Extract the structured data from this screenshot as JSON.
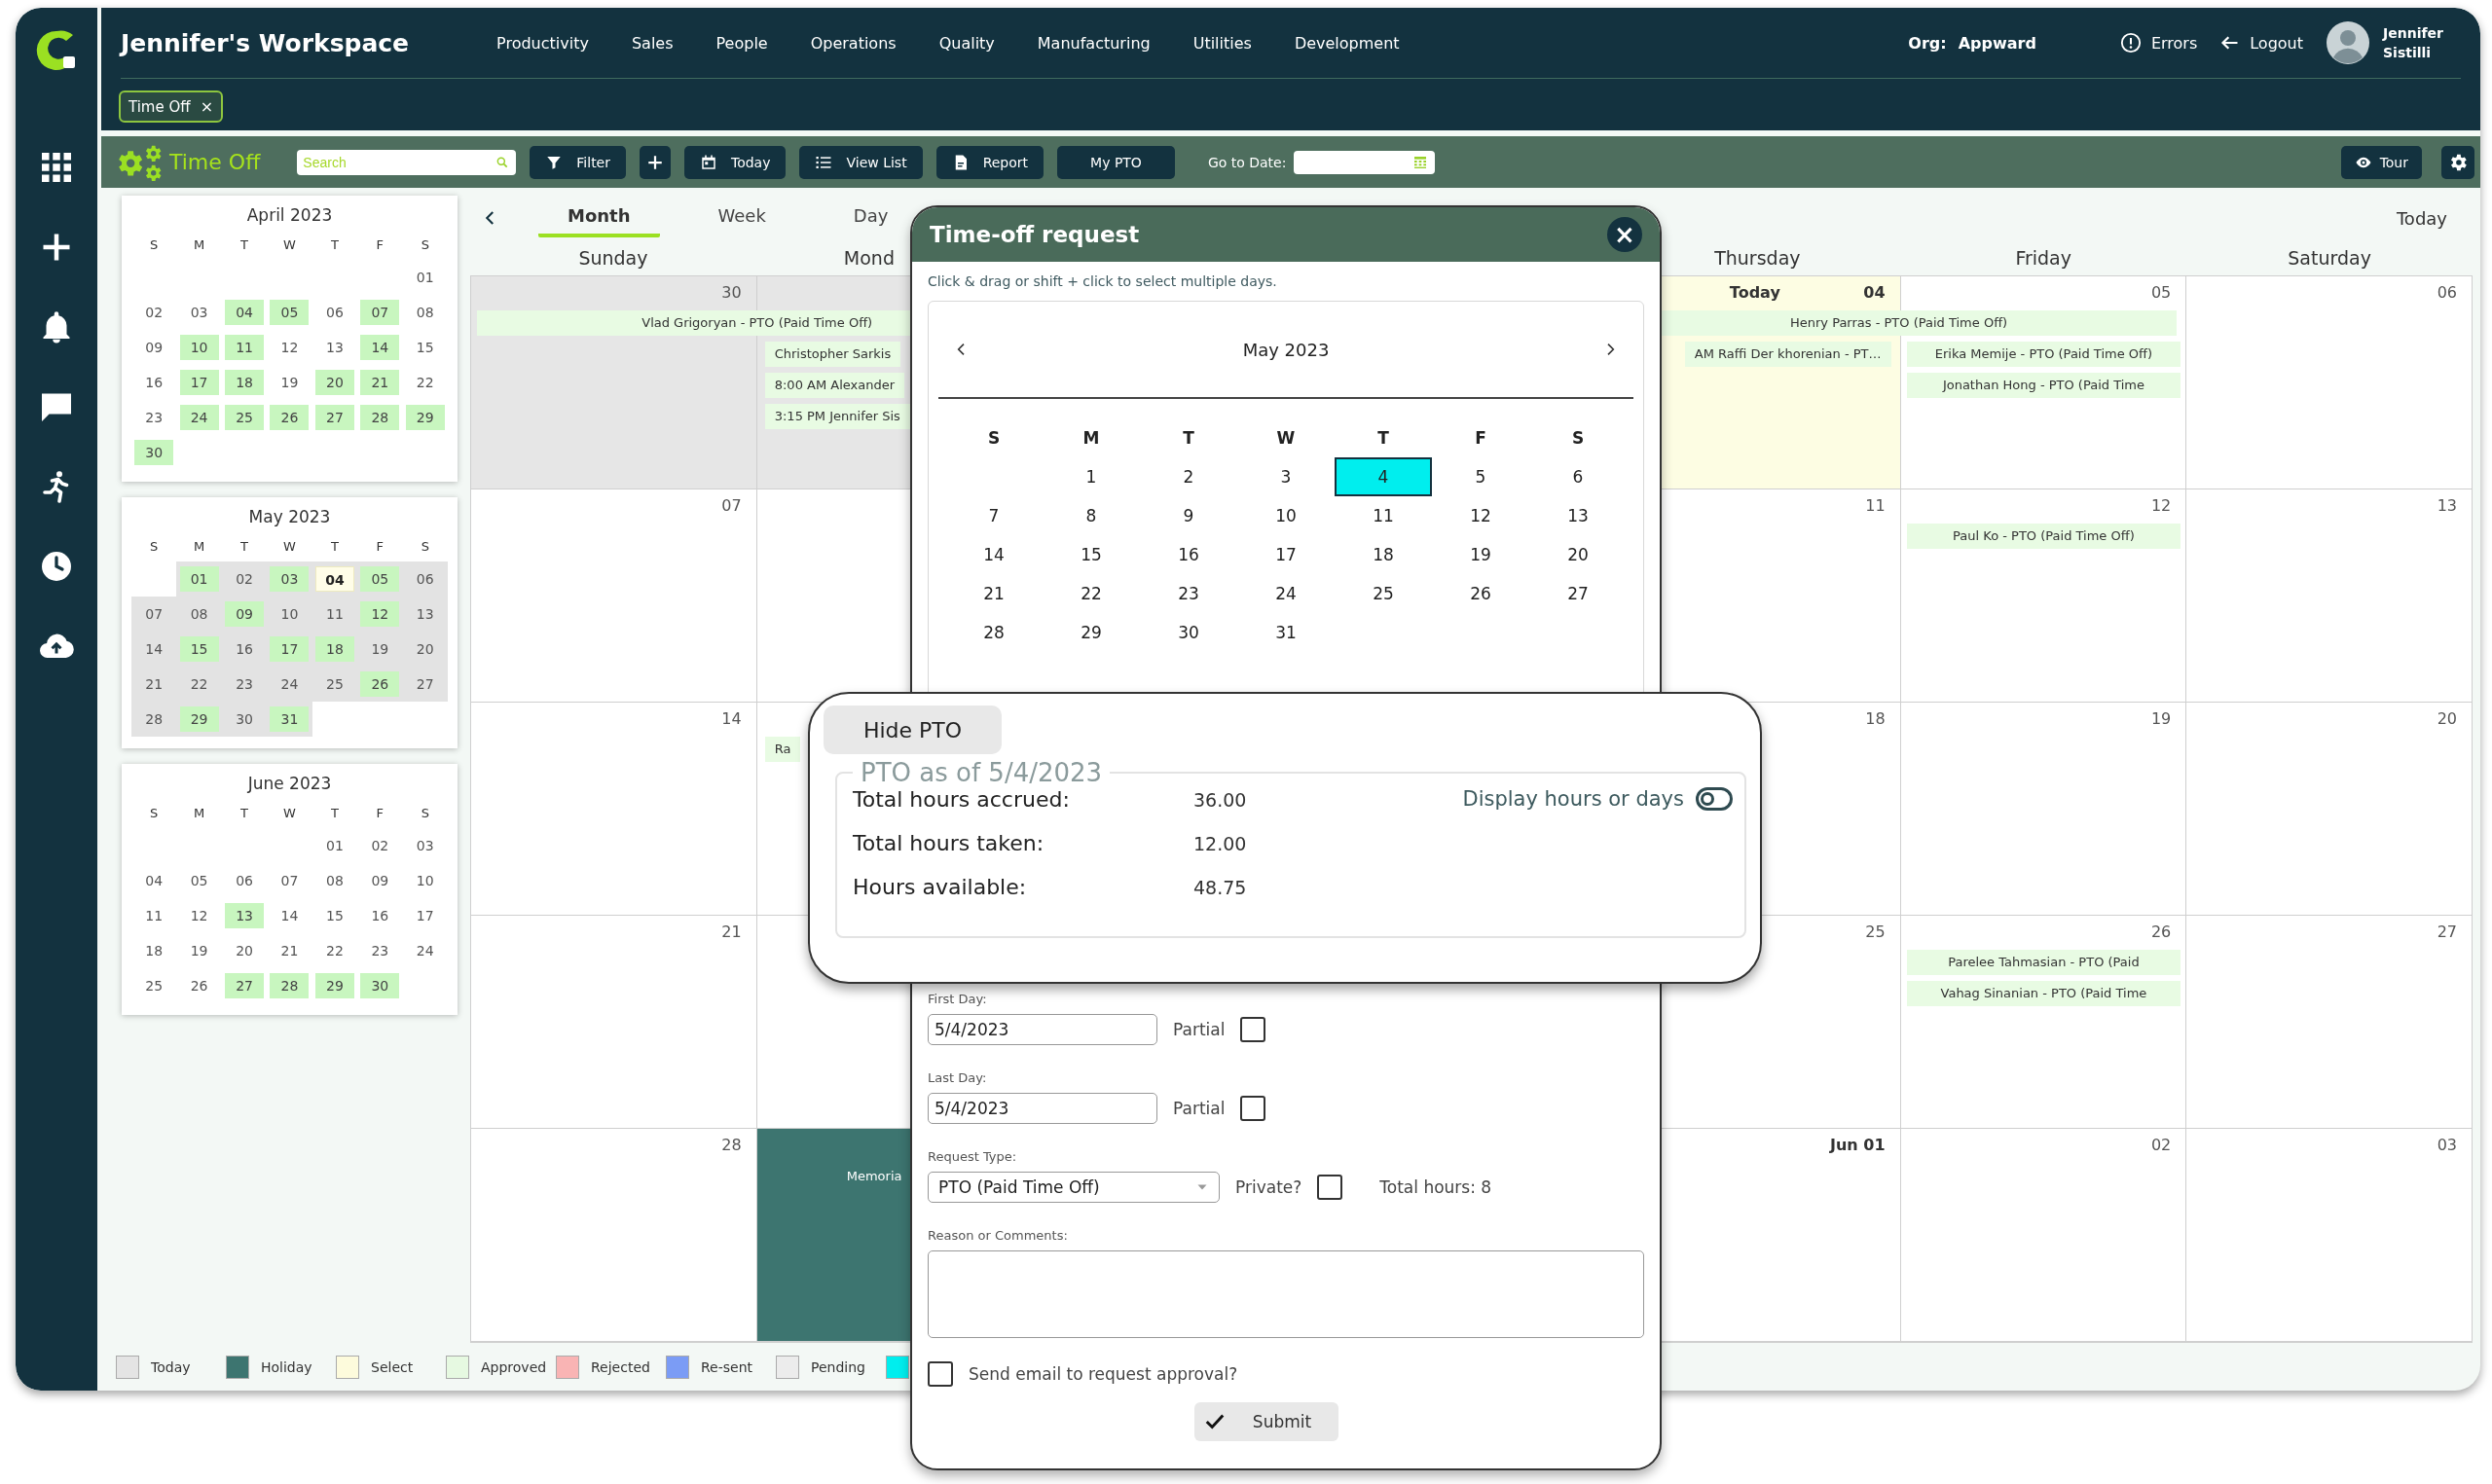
{
  "header": {
    "title": "Jennifer's Workspace",
    "nav": [
      "Productivity",
      "Sales",
      "People",
      "Operations",
      "Quality",
      "Manufacturing",
      "Utilities",
      "Development"
    ],
    "org_label": "Org:",
    "org": "Appward",
    "errors": "Errors",
    "logout": "Logout",
    "user": "Jennifer Sistilli"
  },
  "open_tabs": [
    {
      "label": "Time Off",
      "close": "×"
    }
  ],
  "toolbar": {
    "title": "Time Off",
    "search": {
      "placeholder": "Search"
    },
    "buttons": [
      {
        "kind": "filter",
        "label": "Filter"
      },
      {
        "kind": "add"
      },
      {
        "kind": "today",
        "label": "Today"
      },
      {
        "kind": "list",
        "label": "View List"
      },
      {
        "kind": "report",
        "label": "Report"
      },
      {
        "kind": "plain",
        "label": "My PTO"
      }
    ],
    "goto_label": "Go to Date:",
    "tour": "Tour"
  },
  "mini_calendars": [
    {
      "title": "April 2023",
      "in_view": false,
      "weekdays": [
        "S",
        "M",
        "T",
        "W",
        "T",
        "F",
        "S"
      ],
      "weeks": [
        [
          {
            "kind": "blank"
          },
          {
            "kind": "blank"
          },
          {
            "kind": "blank"
          },
          {
            "kind": "blank"
          },
          {
            "kind": "blank"
          },
          {
            "kind": "blank"
          },
          {
            "day": "01",
            "kind": "plain"
          }
        ],
        [
          {
            "day": "02",
            "kind": "plain"
          },
          {
            "day": "03",
            "kind": "plain"
          },
          {
            "day": "04",
            "kind": "pto"
          },
          {
            "day": "05",
            "kind": "pto"
          },
          {
            "day": "06",
            "kind": "plain"
          },
          {
            "day": "07",
            "kind": "pto"
          },
          {
            "day": "08",
            "kind": "plain"
          }
        ],
        [
          {
            "day": "09",
            "kind": "plain"
          },
          {
            "day": "10",
            "kind": "pto"
          },
          {
            "day": "11",
            "kind": "pto"
          },
          {
            "day": "12",
            "kind": "plain"
          },
          {
            "day": "13",
            "kind": "plain"
          },
          {
            "day": "14",
            "kind": "pto"
          },
          {
            "day": "15",
            "kind": "plain"
          }
        ],
        [
          {
            "day": "16",
            "kind": "plain"
          },
          {
            "day": "17",
            "kind": "pto"
          },
          {
            "day": "18",
            "kind": "pto"
          },
          {
            "day": "19",
            "kind": "plain"
          },
          {
            "day": "20",
            "kind": "pto"
          },
          {
            "day": "21",
            "kind": "pto"
          },
          {
            "day": "22",
            "kind": "plain"
          }
        ],
        [
          {
            "day": "23",
            "kind": "plain"
          },
          {
            "day": "24",
            "kind": "pto"
          },
          {
            "day": "25",
            "kind": "pto"
          },
          {
            "day": "26",
            "kind": "pto"
          },
          {
            "day": "27",
            "kind": "pto"
          },
          {
            "day": "28",
            "kind": "pto"
          },
          {
            "day": "29",
            "kind": "pto"
          }
        ],
        [
          {
            "day": "30",
            "kind": "pto"
          }
        ]
      ]
    },
    {
      "title": "May 2023",
      "in_view": true,
      "weekdays": [
        "S",
        "M",
        "T",
        "W",
        "T",
        "F",
        "S"
      ],
      "weeks": [
        [
          {
            "kind": "blank"
          },
          {
            "day": "01",
            "kind": "pto"
          },
          {
            "day": "02",
            "kind": "plain"
          },
          {
            "day": "03",
            "kind": "pto"
          },
          {
            "day": "04",
            "kind": "today"
          },
          {
            "day": "05",
            "kind": "pto"
          },
          {
            "day": "06",
            "kind": "plain"
          }
        ],
        [
          {
            "day": "07",
            "kind": "plain"
          },
          {
            "day": "08",
            "kind": "plain"
          },
          {
            "day": "09",
            "kind": "pto"
          },
          {
            "day": "10",
            "kind": "plain"
          },
          {
            "day": "11",
            "kind": "plain"
          },
          {
            "day": "12",
            "kind": "pto"
          },
          {
            "day": "13",
            "kind": "plain"
          }
        ],
        [
          {
            "day": "14",
            "kind": "plain"
          },
          {
            "day": "15",
            "kind": "pto"
          },
          {
            "day": "16",
            "kind": "plain"
          },
          {
            "day": "17",
            "kind": "pto"
          },
          {
            "day": "18",
            "kind": "pto"
          },
          {
            "day": "19",
            "kind": "plain"
          },
          {
            "day": "20",
            "kind": "plain"
          }
        ],
        [
          {
            "day": "21",
            "kind": "plain"
          },
          {
            "day": "22",
            "kind": "plain"
          },
          {
            "day": "23",
            "kind": "plain"
          },
          {
            "day": "24",
            "kind": "plain"
          },
          {
            "day": "25",
            "kind": "plain"
          },
          {
            "day": "26",
            "kind": "pto"
          },
          {
            "day": "27",
            "kind": "plain"
          }
        ],
        [
          {
            "day": "28",
            "kind": "plain"
          },
          {
            "day": "29",
            "kind": "pto"
          },
          {
            "day": "30",
            "kind": "plain"
          },
          {
            "day": "31",
            "kind": "pto"
          }
        ]
      ]
    },
    {
      "title": "June 2023",
      "in_view": false,
      "weekdays": [
        "S",
        "M",
        "T",
        "W",
        "T",
        "F",
        "S"
      ],
      "weeks": [
        [
          {
            "kind": "blank"
          },
          {
            "kind": "blank"
          },
          {
            "kind": "blank"
          },
          {
            "kind": "blank"
          },
          {
            "day": "01",
            "kind": "plain"
          },
          {
            "day": "02",
            "kind": "plain"
          },
          {
            "day": "03",
            "kind": "plain"
          }
        ],
        [
          {
            "day": "04",
            "kind": "plain"
          },
          {
            "day": "05",
            "kind": "plain"
          },
          {
            "day": "06",
            "kind": "plain"
          },
          {
            "day": "07",
            "kind": "plain"
          },
          {
            "day": "08",
            "kind": "plain"
          },
          {
            "day": "09",
            "kind": "plain"
          },
          {
            "day": "10",
            "kind": "plain"
          }
        ],
        [
          {
            "day": "11",
            "kind": "plain"
          },
          {
            "day": "12",
            "kind": "plain"
          },
          {
            "day": "13",
            "kind": "pto"
          },
          {
            "day": "14",
            "kind": "plain"
          },
          {
            "day": "15",
            "kind": "plain"
          },
          {
            "day": "16",
            "kind": "plain"
          },
          {
            "day": "17",
            "kind": "plain"
          }
        ],
        [
          {
            "day": "18",
            "kind": "plain"
          },
          {
            "day": "19",
            "kind": "plain"
          },
          {
            "day": "20",
            "kind": "plain"
          },
          {
            "day": "21",
            "kind": "plain"
          },
          {
            "day": "22",
            "kind": "plain"
          },
          {
            "day": "23",
            "kind": "plain"
          },
          {
            "day": "24",
            "kind": "plain"
          }
        ],
        [
          {
            "day": "25",
            "kind": "plain"
          },
          {
            "day": "26",
            "kind": "plain"
          },
          {
            "day": "27",
            "kind": "pto"
          },
          {
            "day": "28",
            "kind": "pto"
          },
          {
            "day": "29",
            "kind": "pto"
          },
          {
            "day": "30",
            "kind": "pto"
          }
        ]
      ]
    }
  ],
  "calendar": {
    "views": [
      {
        "label": "Month",
        "selected": true
      },
      {
        "label": "Week",
        "selected": false
      },
      {
        "label": "Day",
        "selected": false
      }
    ],
    "today": "Today",
    "weekdays": [
      {
        "kind": "label",
        "label": "Sunday"
      },
      {
        "kind": "label",
        "label": "Mond"
      },
      {
        "kind": "hidden"
      },
      {
        "kind": "hidden"
      },
      {
        "kind": "label",
        "label": "Thursday"
      },
      {
        "kind": "label",
        "label": "Friday"
      },
      {
        "kind": "label",
        "label": "Saturday"
      }
    ],
    "weeks": [
      {
        "days": [
          {
            "date": "30",
            "kind": "past",
            "events": [
              {
                "text": "Vlad Grigoryan - PTO (Paid Time Off)",
                "continues": true
              }
            ]
          },
          {
            "kind": "past",
            "events": [
              {
                "text": "Christopher Sarkis",
                "continues": false
              },
              {
                "text": "8:00 AM Alexander",
                "continues": false
              },
              {
                "text": "3:15 PM Jennifer Sis",
                "continues": false
              }
            ]
          },
          {
            "kind": "covered"
          },
          {
            "kind": "covered"
          },
          {
            "label": "Today",
            "date": "04",
            "kind": "today",
            "events": [
              {
                "text": "Henry Parras - PTO (Paid Time Off)",
                "continues": true
              },
              {
                "text": "AM Raffi Der khorenian - PT…",
                "continues": false
              }
            ]
          },
          {
            "date": "05",
            "kind": "plain",
            "events": [
              {
                "text": "Erika Memije - PTO (Paid Time Off)",
                "continues": false
              },
              {
                "text": "Jonathan Hong - PTO (Paid Time",
                "continues": false
              }
            ]
          },
          {
            "date": "06",
            "kind": "plain"
          }
        ]
      },
      {
        "days": [
          {
            "date": "07",
            "kind": "plain"
          },
          {
            "kind": "plain"
          },
          {
            "kind": "covered"
          },
          {
            "kind": "covered"
          },
          {
            "date": "11",
            "kind": "plain"
          },
          {
            "date": "12",
            "kind": "plain",
            "events": [
              {
                "text": "Paul Ko - PTO (Paid Time Off)",
                "continues": false
              }
            ]
          },
          {
            "date": "13",
            "kind": "plain"
          }
        ]
      },
      {
        "days": [
          {
            "date": "14",
            "kind": "plain"
          },
          {
            "kind": "plain",
            "events": [
              {
                "text": "Ra",
                "continues": false
              }
            ]
          },
          {
            "kind": "covered"
          },
          {
            "kind": "covered"
          },
          {
            "date": "18",
            "kind": "plain"
          },
          {
            "date": "19",
            "kind": "plain"
          },
          {
            "date": "20",
            "kind": "plain"
          }
        ]
      },
      {
        "days": [
          {
            "date": "21",
            "kind": "plain"
          },
          {
            "kind": "plain"
          },
          {
            "kind": "covered"
          },
          {
            "kind": "covered"
          },
          {
            "date": "25",
            "kind": "plain"
          },
          {
            "date": "26",
            "kind": "plain",
            "events": [
              {
                "text": "Parelee Tahmasian - PTO (Paid",
                "continues": false
              },
              {
                "text": "Vahag Sinanian - PTO (Paid Time",
                "continues": false
              }
            ]
          },
          {
            "date": "27",
            "kind": "plain"
          }
        ]
      },
      {
        "days": [
          {
            "date": "28",
            "kind": "plain"
          },
          {
            "kind": "holiday",
            "holiday": "Memoria"
          },
          {
            "kind": "covered"
          },
          {
            "kind": "covered"
          },
          {
            "date": "Jun 01",
            "kind": "first"
          },
          {
            "date": "02",
            "kind": "plain"
          },
          {
            "date": "03",
            "kind": "plain"
          }
        ]
      }
    ]
  },
  "legend": [
    {
      "label": "Today",
      "color": "#e4e4e4"
    },
    {
      "label": "Holiday",
      "color": "#3d7570"
    },
    {
      "label": "Select",
      "color": "#fdfbdc"
    },
    {
      "label": "Approved",
      "color": "#e6f9e1"
    },
    {
      "label": "Rejected",
      "color": "#f9b4b4"
    },
    {
      "label": "Re-sent",
      "color": "#7b9cf5"
    },
    {
      "label": "Pending",
      "color": "#ececec"
    },
    {
      "color": "#00eeee"
    }
  ],
  "dialog": {
    "title": "Time-off request",
    "close": "×",
    "hint": "Click & drag or shift + click to select multiple days.",
    "month": "May 2023",
    "weekdays": [
      "S",
      "M",
      "T",
      "W",
      "T",
      "F",
      "S"
    ],
    "days": [
      {
        "kind": "blank"
      },
      {
        "kind": "day",
        "day": "1",
        "selected": false
      },
      {
        "kind": "day",
        "day": "2",
        "selected": false
      },
      {
        "kind": "day",
        "day": "3",
        "selected": false
      },
      {
        "kind": "day",
        "day": "4",
        "selected": true
      },
      {
        "kind": "day",
        "day": "5",
        "selected": false
      },
      {
        "kind": "day",
        "day": "6",
        "selected": false
      },
      {
        "kind": "day",
        "day": "7",
        "selected": false
      },
      {
        "kind": "day",
        "day": "8",
        "selected": false
      },
      {
        "kind": "day",
        "day": "9",
        "selected": false
      },
      {
        "kind": "day",
        "day": "10",
        "selected": false
      },
      {
        "kind": "day",
        "day": "11",
        "selected": false
      },
      {
        "kind": "day",
        "day": "12",
        "selected": false
      },
      {
        "kind": "day",
        "day": "13",
        "selected": false
      },
      {
        "kind": "day",
        "day": "14",
        "selected": false
      },
      {
        "kind": "day",
        "day": "15",
        "selected": false
      },
      {
        "kind": "day",
        "day": "16",
        "selected": false
      },
      {
        "kind": "day",
        "day": "17",
        "selected": false
      },
      {
        "kind": "day",
        "day": "18",
        "selected": false
      },
      {
        "kind": "day",
        "day": "19",
        "selected": false
      },
      {
        "kind": "day",
        "day": "20",
        "selected": false
      },
      {
        "kind": "day",
        "day": "21",
        "selected": false
      },
      {
        "kind": "day",
        "day": "22",
        "selected": false
      },
      {
        "kind": "day",
        "day": "23",
        "selected": false
      },
      {
        "kind": "day",
        "day": "24",
        "selected": false
      },
      {
        "kind": "day",
        "day": "25",
        "selected": false
      },
      {
        "kind": "day",
        "day": "26",
        "selected": false
      },
      {
        "kind": "day",
        "day": "27",
        "selected": false
      },
      {
        "kind": "day",
        "day": "28",
        "selected": false
      },
      {
        "kind": "day",
        "day": "29",
        "selected": false
      },
      {
        "kind": "day",
        "day": "30",
        "selected": false
      },
      {
        "kind": "day",
        "day": "31",
        "selected": false
      }
    ],
    "first_day": {
      "label": "First Day:",
      "value": "5/4/2023",
      "partial_label": "Partial",
      "partial": false
    },
    "last_day": {
      "label": "Last Day:",
      "value": "5/4/2023",
      "partial_label": "Partial",
      "partial": false
    },
    "request_type": {
      "label": "Request Type:",
      "value": "PTO (Paid Time Off)"
    },
    "private": {
      "label": "Private?",
      "checked": false
    },
    "total_hours": "Total hours: 8",
    "reason": {
      "label": "Reason or Comments:"
    },
    "send_email": {
      "label": "Send email to request approval?",
      "checked": false
    },
    "submit": "Submit"
  },
  "pto": {
    "hide_button": "Hide PTO",
    "legend": "PTO as of 5/4/2023",
    "rows": [
      {
        "label": "Total hours accrued:",
        "value": "36.00"
      },
      {
        "label": "Total hours taken:",
        "value": "12.00"
      },
      {
        "label": "Hours available:",
        "value": "48.75"
      }
    ],
    "display_toggle": {
      "label": "Display hours or days",
      "on": false
    }
  }
}
